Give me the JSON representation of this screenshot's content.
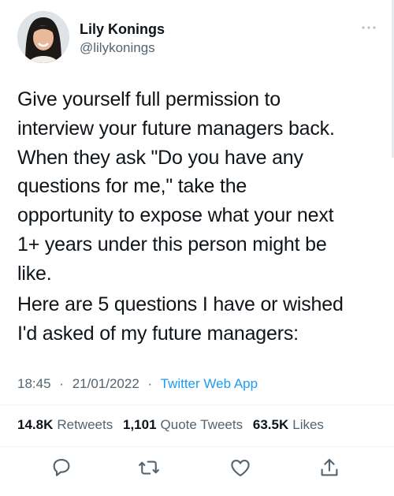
{
  "author": {
    "display_name": "Lily Konings",
    "handle": "@lilykonings",
    "avatar": "user-photo"
  },
  "tweet": {
    "paragraphs": [
      "Give yourself full permission to\ninterview your future managers back.\nWhen they ask \"Do you have any\nquestions for me,\" take the\nopportunity to expose what your next\n1+ years under this person might be\nlike.",
      "Here are 5 questions I have or wished\nI'd asked of my future managers:"
    ],
    "time": "18:45",
    "date": "21/01/2022",
    "separator": "·",
    "source": "Twitter Web App"
  },
  "stats": {
    "retweets_count": "14.8K",
    "retweets_label": "Retweets",
    "quotes_count": "1,101",
    "quotes_label": "Quote Tweets",
    "likes_count": "63.5K",
    "likes_label": "Likes"
  },
  "actions": [
    "reply-icon",
    "retweet-icon",
    "like-icon",
    "share-icon"
  ],
  "colors": {
    "text": "#0f1419",
    "secondary": "#536471",
    "link": "#1d9bf0",
    "divider": "#eff3f4"
  }
}
